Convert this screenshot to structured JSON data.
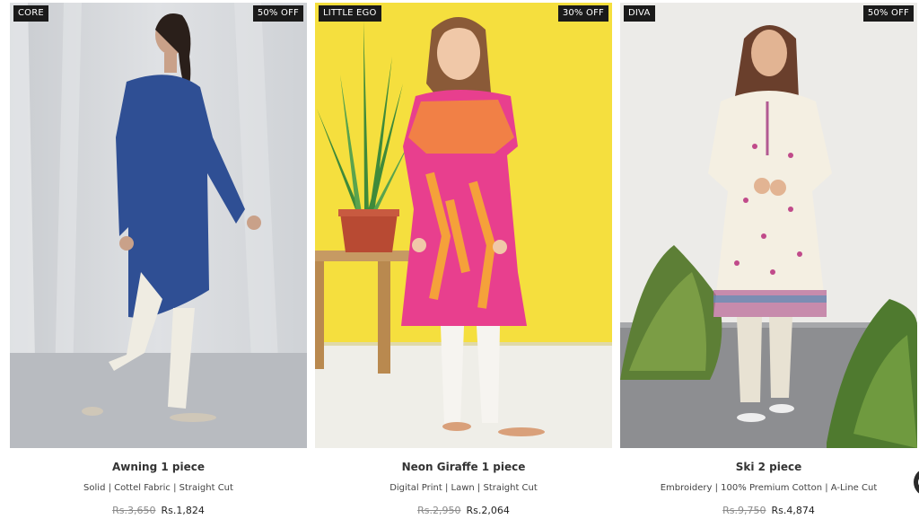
{
  "products": [
    {
      "brand": "CORE",
      "discount": "50% OFF",
      "name": "Awning 1 piece",
      "description": "Solid | Cottel Fabric | Straight Cut",
      "old_price": "Rs.3,650",
      "price": "Rs.1,824"
    },
    {
      "brand": "LITTLE EGO",
      "discount": "30% OFF",
      "name": "Neon Giraffe 1 piece",
      "description": "Digital Print | Lawn | Straight Cut",
      "old_price": "Rs.2,950",
      "price": "Rs.2,064"
    },
    {
      "brand": "DIVA",
      "discount": "50% OFF",
      "name": "Ski 2 piece",
      "description": "Embroidery | 100% Premium Cotton | A-Line Cut",
      "old_price": "Rs.9,750",
      "price": "Rs.4,874"
    }
  ]
}
